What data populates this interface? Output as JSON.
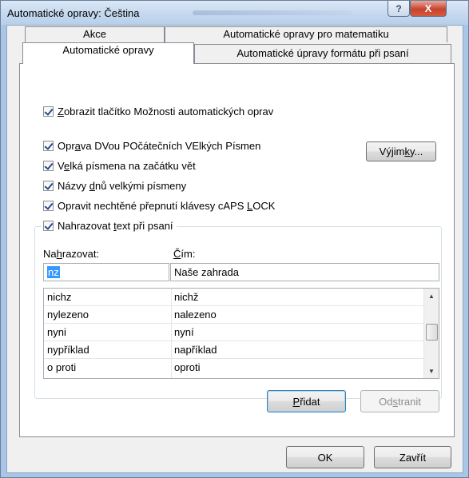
{
  "window": {
    "title": "Automatické opravy: Čeština",
    "help_label": "?",
    "close_label": "X"
  },
  "tabs": {
    "row1": [
      "Akce",
      "Automatické opravy pro matematiku"
    ],
    "row2": [
      "Automatické opravy",
      "Automatické úpravy formátu při psaní"
    ],
    "active": "Automatické opravy"
  },
  "options": {
    "show_buttons": {
      "checked": true,
      "pre": "",
      "accel": "Z",
      "post": "obrazit tlačítko Možnosti automatických oprav"
    },
    "two_initial_caps": {
      "checked": true,
      "pre": "Opr",
      "accel": "a",
      "post": "va DVou POčátečních VElkých Písmen"
    },
    "capitalize_sentences": {
      "checked": true,
      "pre": "V",
      "accel": "e",
      "post": "lká písmena na začátku vět"
    },
    "capitalize_days": {
      "checked": true,
      "pre": "Názvy ",
      "accel": "d",
      "post": "nů velkými písmeny"
    },
    "caps_lock": {
      "checked": true,
      "pre": "Opravit nechtěné přepnutí klávesy cAPS ",
      "accel": "L",
      "post": "OCK"
    },
    "replace_text": {
      "checked": true,
      "pre": "Nahrazovat ",
      "accel": "t",
      "post": "ext při psaní"
    }
  },
  "buttons": {
    "exceptions": {
      "pre": "Výjim",
      "accel": "k",
      "post": "y..."
    },
    "add": {
      "pre": "",
      "accel": "P",
      "post": "řidat"
    },
    "delete": {
      "pre": "Od",
      "accel": "s",
      "post": "tranit"
    },
    "ok": "OK",
    "close": "Zavřít"
  },
  "replace": {
    "replace_label_pre": "Na",
    "replace_label_accel": "h",
    "replace_label_post": "razovat:",
    "with_label_pre": "",
    "with_label_accel": "Č",
    "with_label_post": "ím:",
    "replace_value": "nz",
    "with_value": "Naše zahrada"
  },
  "entries": [
    {
      "from": "nichz",
      "to": "nichž"
    },
    {
      "from": "nylezeno",
      "to": "nalezeno"
    },
    {
      "from": "nyni",
      "to": "nyní"
    },
    {
      "from": "nypříklad",
      "to": "například"
    },
    {
      "from": "o proti",
      "to": "oproti"
    }
  ],
  "scrollbar": {
    "up_icon": "▲",
    "down_icon": "▼"
  },
  "colors": {
    "selection": "#3399ff",
    "close_button": "#c7442f"
  }
}
